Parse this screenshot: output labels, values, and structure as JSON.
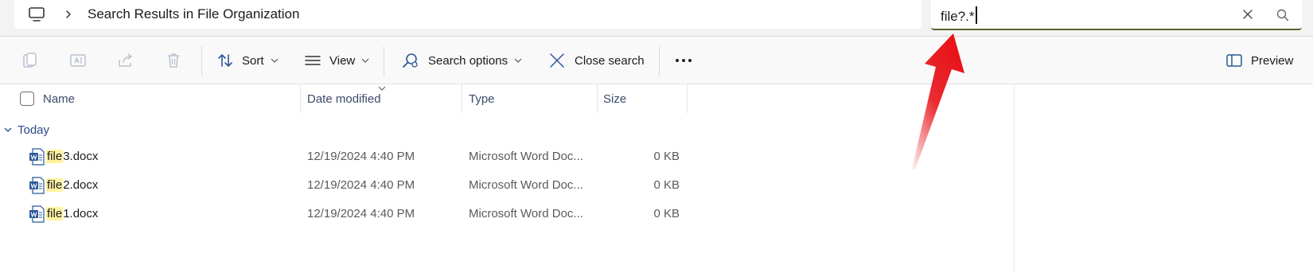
{
  "address_bar": {
    "location_icon": "computer-monitor-icon",
    "separator_icon": "chevron-right-icon",
    "path_text": "Search Results in File Organization"
  },
  "search": {
    "value": "file?.*",
    "clear_icon": "close-icon",
    "submit_icon": "search-icon"
  },
  "toolbar": {
    "copy_icon": "copy-icon",
    "rename_icon": "rename-icon",
    "share_icon": "share-icon",
    "delete_icon": "delete-icon",
    "sort_label": "Sort",
    "view_label": "View",
    "search_options_label": "Search options",
    "close_search_label": "Close search",
    "more_icon": "more-icon",
    "preview_label": "Preview"
  },
  "columns": {
    "name": "Name",
    "date_modified": "Date modified",
    "type": "Type",
    "size": "Size"
  },
  "group": {
    "label": "Today"
  },
  "files": [
    {
      "match": "file",
      "rest": "3.docx",
      "date": "12/19/2024 4:40 PM",
      "type": "Microsoft Word Doc...",
      "size": "0 KB"
    },
    {
      "match": "file",
      "rest": "2.docx",
      "date": "12/19/2024 4:40 PM",
      "type": "Microsoft Word Doc...",
      "size": "0 KB"
    },
    {
      "match": "file",
      "rest": "1.docx",
      "date": "12/19/2024 4:40 PM",
      "type": "Microsoft Word Doc...",
      "size": "0 KB"
    }
  ],
  "colors": {
    "accent": "#0067c0",
    "search_underline": "#5a5f2a",
    "highlight": "#fff3a0",
    "annotation_arrow": "#e8141a"
  }
}
